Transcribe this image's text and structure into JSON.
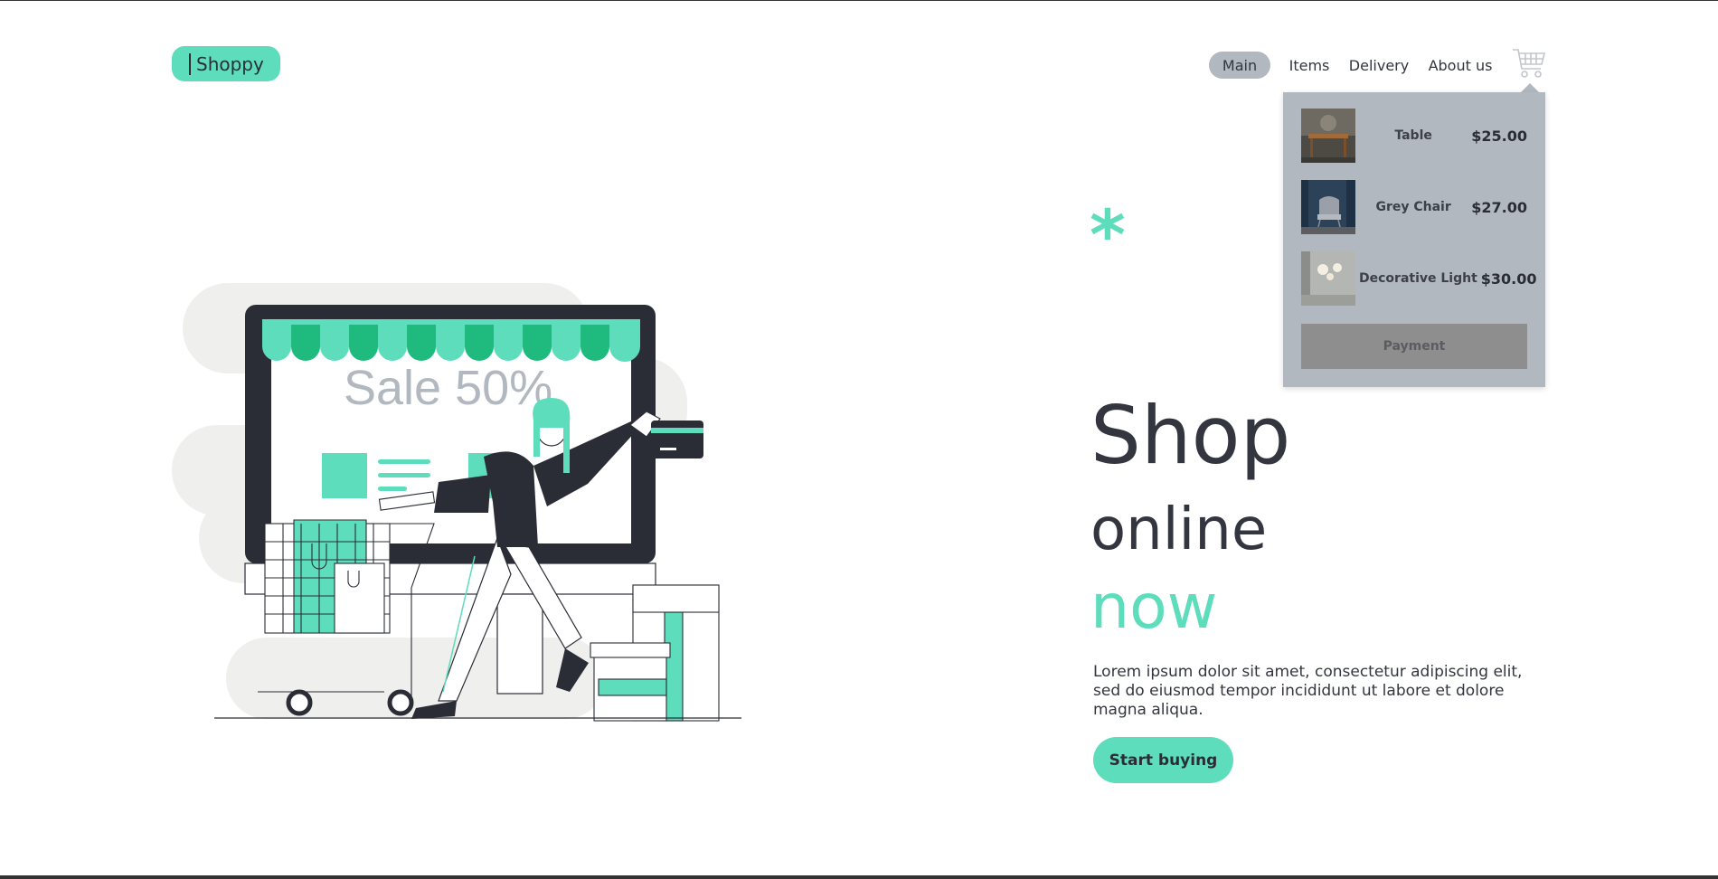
{
  "header": {
    "logo_text": "Shoppy",
    "nav": [
      {
        "label": "Main",
        "active": true
      },
      {
        "label": "Items",
        "active": false
      },
      {
        "label": "Delivery",
        "active": false
      },
      {
        "label": "About us",
        "active": false
      }
    ],
    "cart_icon": "shopping-cart-icon"
  },
  "cart_dropdown": {
    "items": [
      {
        "name": "Table",
        "price": "$25.00",
        "thumb_icon": "table-photo"
      },
      {
        "name": "Grey Chair",
        "price": "$27.00",
        "thumb_icon": "chair-photo"
      },
      {
        "name": "Decorative Light",
        "price": "$30.00",
        "thumb_icon": "lamp-photo"
      }
    ],
    "payment_label": "Payment"
  },
  "hero": {
    "asterisk": "*",
    "line1": "Shop",
    "line2": "online",
    "line3": "now",
    "description": "Lorem ipsum dolor sit amet, consectetur adipiscing elit, sed do eiusmod tempor incididunt ut labore et dolore magna aliqua.",
    "cta_label": "Start buying"
  },
  "illustration": {
    "sale_text": "Sale 50%"
  },
  "colors": {
    "accent": "#5dddbc",
    "accent_dark": "#1fba7d",
    "dark": "#2b2d36",
    "grey_panel": "#b2b8bf",
    "payment_grey": "#8e8e8e"
  }
}
